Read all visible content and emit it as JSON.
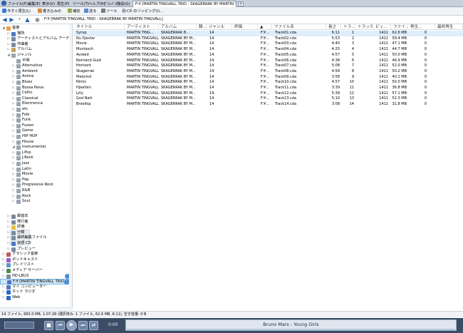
{
  "menubar": {
    "items": [
      "ファイル(F)",
      "編集(E)",
      "表示(V)",
      "再生(P)",
      "ツール(T)",
      "ヘルプ(H)",
      "ｸﾞﾛｰﾊﾞﾙ階段(G)"
    ],
    "tab_label": "F:¥ [MARTIN TINGVALL TRIO - SKAGERRAK BY MARTIN TINGVALL]",
    "tab_add": "+"
  },
  "toolbar": {
    "buttons": [
      "今すぐ再生(L)",
      "書き込みの",
      "補完",
      "送る",
      "ツール",
      "CD のリッピング(I)..."
    ]
  },
  "address": {
    "text": "F:¥ [MARTIN TINGVALL TRIO - SKAGERRAK BY MARTIN TINGVALL]"
  },
  "tree": {
    "items": [
      {
        "label": "音楽",
        "indent": 1,
        "exp": "◢",
        "color": "#e8a33b"
      },
      {
        "label": "場所",
        "indent": 2,
        "exp": "▷",
        "color": "#4a77c4"
      },
      {
        "label": "アーティストとアルバム アーティスト",
        "indent": 2,
        "exp": "▷",
        "color": "#7a8aa0"
      },
      {
        "label": "作曲者",
        "indent": 2,
        "exp": "▷",
        "color": "#7a8aa0"
      },
      {
        "label": "アルバム",
        "indent": 2,
        "exp": "▷",
        "color": "#c4a25a"
      },
      {
        "label": "ジャンル",
        "indent": 2,
        "exp": "◢",
        "color": "#9aa4b2"
      },
      {
        "label": "不明",
        "indent": 3,
        "exp": "",
        "color": "#9aa4b2"
      },
      {
        "label": "Alternative",
        "indent": 3,
        "exp": "▷",
        "color": "#9aa4b2"
      },
      {
        "label": "Ambient",
        "indent": 3,
        "exp": "▷",
        "color": "#9aa4b2"
      },
      {
        "label": "Anime",
        "indent": 3,
        "exp": "▷",
        "color": "#9aa4b2"
      },
      {
        "label": "Blues",
        "indent": 3,
        "exp": "▷",
        "color": "#9aa4b2"
      },
      {
        "label": "Bossa Nova",
        "indent": 3,
        "exp": "▷",
        "color": "#9aa4b2"
      },
      {
        "label": "Celtic",
        "indent": 3,
        "exp": "▷",
        "color": "#9aa4b2"
      },
      {
        "label": "Classical",
        "indent": 3,
        "exp": "▷",
        "color": "#9aa4b2"
      },
      {
        "label": "Electronica",
        "indent": 3,
        "exp": "▷",
        "color": "#9aa4b2"
      },
      {
        "label": "etc",
        "indent": 3,
        "exp": "▷",
        "color": "#9aa4b2"
      },
      {
        "label": "Folk",
        "indent": 3,
        "exp": "▷",
        "color": "#9aa4b2"
      },
      {
        "label": "Funk",
        "indent": 3,
        "exp": "▷",
        "color": "#9aa4b2"
      },
      {
        "label": "Fusion",
        "indent": 3,
        "exp": "▷",
        "color": "#9aa4b2"
      },
      {
        "label": "Game",
        "indent": 3,
        "exp": "▷",
        "color": "#9aa4b2"
      },
      {
        "label": "HIP HOP",
        "indent": 3,
        "exp": "▷",
        "color": "#9aa4b2"
      },
      {
        "label": "House",
        "indent": 3,
        "exp": "▷",
        "color": "#9aa4b2"
      },
      {
        "label": "Instrumental",
        "indent": 3,
        "exp": "◢",
        "color": "#9aa4b2"
      },
      {
        "label": "J-Pop",
        "indent": 3,
        "exp": "▷",
        "color": "#9aa4b2"
      },
      {
        "label": "J-Rock",
        "indent": 3,
        "exp": "▷",
        "color": "#9aa4b2"
      },
      {
        "label": "Jazz",
        "indent": 3,
        "exp": "▷",
        "color": "#9aa4b2"
      },
      {
        "label": "Latin",
        "indent": 3,
        "exp": "▷",
        "color": "#9aa4b2"
      },
      {
        "label": "Movie",
        "indent": 3,
        "exp": "▷",
        "color": "#9aa4b2"
      },
      {
        "label": "Pop",
        "indent": 3,
        "exp": "▷",
        "color": "#9aa4b2"
      },
      {
        "label": "Progressive Rock",
        "indent": 3,
        "exp": "▷",
        "color": "#9aa4b2"
      },
      {
        "label": "R&B",
        "indent": 3,
        "exp": "▷",
        "color": "#9aa4b2"
      },
      {
        "label": "Rock",
        "indent": 3,
        "exp": "▷",
        "color": "#9aa4b2"
      },
      {
        "label": "Soul",
        "indent": 3,
        "exp": "▷",
        "color": "#9aa4b2"
      }
    ],
    "lower_items": [
      {
        "label": "録音年",
        "indent": 2,
        "exp": "▷",
        "color": "#7a8aa0"
      },
      {
        "label": "発行者",
        "indent": 2,
        "exp": "▷",
        "color": "#7a8aa0"
      },
      {
        "label": "評価",
        "indent": 2,
        "exp": "▷",
        "color": "#e8c23b"
      },
      {
        "label": "分類",
        "indent": 2,
        "exp": "▷",
        "color": "#7a8aa0"
      },
      {
        "label": "最終編集ファイル",
        "indent": 2,
        "exp": "▷",
        "color": "#7a8aa0"
      },
      {
        "label": "仮想 CD",
        "indent": 2,
        "exp": "▷",
        "color": "#4a77c4"
      },
      {
        "label": "プレビュー",
        "indent": 2,
        "exp": "▷",
        "color": "#7a8aa0"
      },
      {
        "label": "クラシック音楽",
        "indent": 1,
        "exp": "▷",
        "color": "#c25a5a"
      },
      {
        "label": "ポッドキャスト",
        "indent": 1,
        "exp": "▷",
        "color": "#9a5ac4"
      },
      {
        "label": "プレイリスト",
        "indent": 1,
        "exp": "▷",
        "color": "#5a9ac4"
      },
      {
        "label": "メディア サーバー",
        "indent": 1,
        "exp": "▷",
        "color": "#4a8a4a"
      },
      {
        "label": "HD-LBU3",
        "indent": 1,
        "exp": "▷",
        "color": "#7a8aa0"
      },
      {
        "label": "F:¥ [MARTIN TINGVALL TRIO - SK",
        "indent": 1,
        "exp": "",
        "color": "#4a77c4",
        "selected": true
      },
      {
        "label": "マイ コンピューター",
        "indent": 1,
        "exp": "▷",
        "color": "#4a77c4"
      },
      {
        "label": "ネット ラジオ",
        "indent": 1,
        "exp": "▷",
        "color": "#2a6bc4"
      },
      {
        "label": "Web",
        "indent": 1,
        "exp": "▷",
        "color": "#2a6bc4"
      }
    ]
  },
  "grid": {
    "columns": [
      {
        "label": "タイトル"
      },
      {
        "label": "アーティスト"
      },
      {
        "label": "アルバム"
      },
      {
        "label": "録..."
      },
      {
        "label": "ジャンル"
      },
      {
        "label": "評価"
      },
      {
        "label": "▲"
      },
      {
        "label": "ファイル名"
      },
      {
        "label": "長さ"
      },
      {
        "label": "トラ..."
      },
      {
        "label": "トラック..."
      },
      {
        "label": "ビッ..."
      },
      {
        "label": "ファイ..."
      },
      {
        "label": "再生..."
      },
      {
        "label": "最終再生"
      }
    ],
    "rows": [
      [
        "Syrup",
        "MARTIN TING...",
        "SKAGERRAK B...",
        "14",
        "",
        "",
        "F:¥...",
        "Track01.cda",
        "6:11",
        "1",
        "1411",
        "62.6 MB",
        "0"
      ],
      [
        "Nu Djevlar",
        "MARTIN TINGVALL...",
        "SKAGERRAK BY M...",
        "14",
        "",
        "",
        "F:¥...",
        "Track02.cda",
        "5:53",
        "2",
        "1411",
        "59.4 MB",
        "0"
      ],
      [
        "Movie",
        "MARTIN TINGVALL...",
        "SKAGERRAK BY M...",
        "14",
        "",
        "",
        "F:¥...",
        "Track03.cda",
        "4:40",
        "3",
        "1411",
        "47.1 MB",
        "0"
      ],
      [
        "Muntasch",
        "MARTIN TINGVALL...",
        "SKAGERRAK BY M...",
        "14",
        "",
        "",
        "F:¥...",
        "Track04.cda",
        "4:25",
        "4",
        "1411",
        "44.7 MB",
        "0"
      ],
      [
        "Avsked",
        "MARTIN TINGVALL...",
        "SKAGERRAK BY M...",
        "14",
        "",
        "",
        "F:¥...",
        "Track05.cda",
        "4:57",
        "5",
        "1411",
        "50.0 MB",
        "0"
      ],
      [
        "Norrland Guld",
        "MARTIN TINGVALL...",
        "SKAGERRAK BY M...",
        "14",
        "",
        "",
        "F:¥...",
        "Track06.cda",
        "4:38",
        "6",
        "1411",
        "46.9 MB",
        "0"
      ],
      [
        "Horisont",
        "MARTIN TINGVALL...",
        "SKAGERRAK BY M...",
        "14",
        "",
        "",
        "F:¥...",
        "Track07.cda",
        "5:08",
        "7",
        "1411",
        "52.0 MB",
        "0"
      ],
      [
        "Skagerrak",
        "MARTIN TINGVALL...",
        "SKAGERRAK BY M...",
        "14",
        "",
        "",
        "F:¥...",
        "Track08.cda",
        "4:58",
        "8",
        "1411",
        "50.2 MB",
        "0"
      ],
      [
        "Medvind",
        "MARTIN TINGVALL...",
        "SKAGERRAK BY M...",
        "14",
        "",
        "",
        "F:¥...",
        "Track09.cda",
        "3:58",
        "9",
        "1411",
        "40.1 MB",
        "0"
      ],
      [
        "Nimis",
        "MARTIN TINGVALL...",
        "SKAGERRAK BY M...",
        "14",
        "",
        "",
        "F:¥...",
        "Track10.cda",
        "4:57",
        "10",
        "1411",
        "50.0 MB",
        "0"
      ],
      [
        "Hjeelten",
        "MARTIN TINGVALL...",
        "SKAGERRAK BY M...",
        "14",
        "",
        "",
        "F:¥...",
        "Track11.cda",
        "3:39",
        "11",
        "1411",
        "36.8 MB",
        "0"
      ],
      [
        "Lilly",
        "MARTIN TINGVALL...",
        "SKAGERRAK BY M...",
        "14",
        "",
        "",
        "F:¥...",
        "Track12.cda",
        "5:39",
        "12",
        "1411",
        "57.1 MB",
        "0"
      ],
      [
        "God Natt",
        "MARTIN TINGVALL...",
        "SKAGERRAK BY M...",
        "14",
        "",
        "",
        "F:¥...",
        "Track13.cda",
        "5:10",
        "13",
        "1411",
        "52.3 MB",
        "0"
      ],
      [
        "Broellop",
        "MARTIN TINGVALL...",
        "SKAGERRAK BY M...",
        "14",
        "",
        "",
        "F:¥...",
        "Track14.cda",
        "3:08",
        "14",
        "1411",
        "31.8 MB",
        "0"
      ]
    ]
  },
  "status": {
    "text": "14 ファイル, 683.0 MB, 1:07:28 (選択済み: 1 ファイル, 62.6 MB, 6:11), 空き容量: 0 B"
  },
  "player": {
    "time": "0:00",
    "now_playing": "Bruno Mars - Young Girls",
    "buttons": [
      "⏮",
      "▶",
      "⏭",
      "⇄"
    ]
  }
}
